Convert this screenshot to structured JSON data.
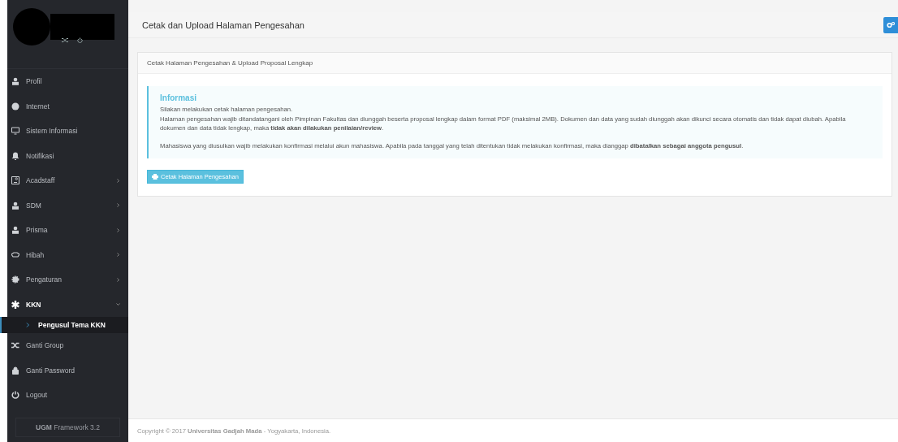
{
  "sidebar": {
    "items": [
      {
        "label": "Profil",
        "has_submenu": false,
        "expanded": false
      },
      {
        "label": "Internet",
        "has_submenu": false,
        "expanded": false
      },
      {
        "label": "Sistem Informasi",
        "has_submenu": false,
        "expanded": false
      },
      {
        "label": "Notifikasi",
        "has_submenu": false,
        "expanded": false
      },
      {
        "label": "Acadstaff",
        "has_submenu": true,
        "expanded": false
      },
      {
        "label": "SDM",
        "has_submenu": true,
        "expanded": false
      },
      {
        "label": "Prisma",
        "has_submenu": true,
        "expanded": false
      },
      {
        "label": "Hibah",
        "has_submenu": true,
        "expanded": false
      },
      {
        "label": "Pengaturan",
        "has_submenu": true,
        "expanded": false
      },
      {
        "label": "KKN",
        "has_submenu": true,
        "expanded": true,
        "children": [
          {
            "label": "Pengusul Tema KKN",
            "selected": true
          }
        ]
      },
      {
        "label": "Ganti Group",
        "has_submenu": false,
        "expanded": false
      },
      {
        "label": "Ganti Password",
        "has_submenu": false,
        "expanded": false
      },
      {
        "label": "Logout",
        "has_submenu": false,
        "expanded": false
      }
    ],
    "footer_badge": "**UGM** Framework 3.2"
  },
  "page": {
    "title": "Cetak dan Upload Halaman Pengesahan"
  },
  "panel": {
    "heading": "Cetak Halaman Pengesahan & Upload Proposal Lengkap",
    "info": {
      "title": "Informasi",
      "lines": [
        "Silakan melakukan cetak halaman pengesahan.",
        "Halaman pengesahan wajib ditandatangani oleh Pimpinan Fakultas dan diunggah beserta proposal lengkap dalam format PDF (maksimal 2MB). Dokumen dan data yang sudah diunggah akan dikunci secara otomatis dan tidak dapat diubah. Apabila dokumen dan data tidak lengkap, maka **tidak akan dilakukan penilaian/review**."
      ],
      "note": "Mahasiswa yang diusulkan wajib melakukan konfirmasi melalui akun mahasiswa. Apabila pada tanggal yang telah ditentukan tidak melakukan konfirmasi, maka dianggap **dibatalkan sebagai anggota pengusul**."
    },
    "button": "Cetak Halaman Pengesahan"
  },
  "footer": "Copyright © 2017 **Universitas Gadjah Mada** - Yogyakarta, Indonesia."
}
